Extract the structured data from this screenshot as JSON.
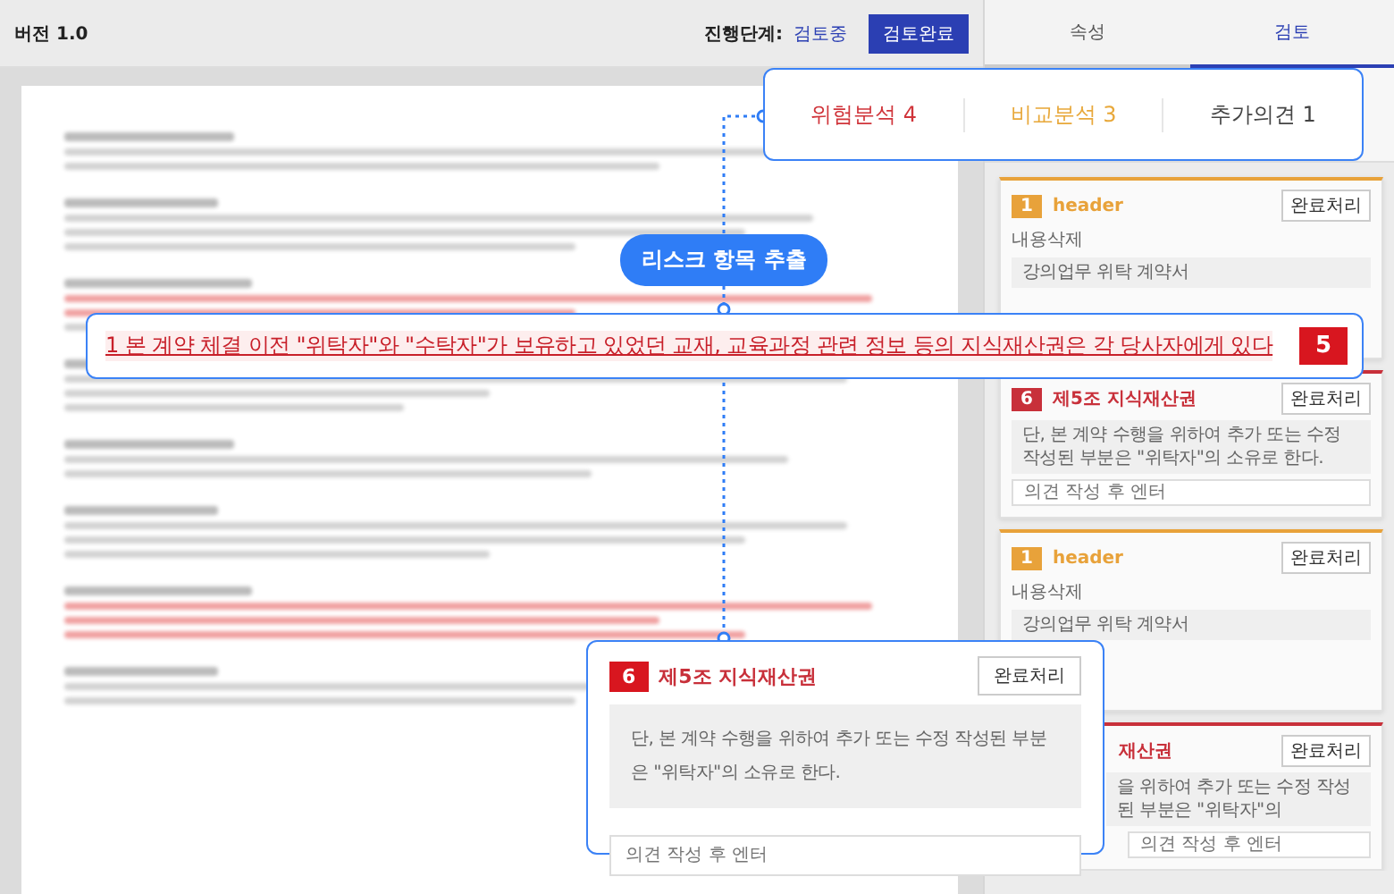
{
  "header": {
    "version": "버전 1.0",
    "stage_label": "진행단계:",
    "stage_value": "검토중",
    "complete_button": "검토완료"
  },
  "panel_tabs": [
    {
      "label": "속성",
      "selected": false
    },
    {
      "label": "검토",
      "selected": true
    }
  ],
  "review_cards": [
    {
      "kind": "header",
      "number": "1",
      "title": "header",
      "button": "완료처리",
      "subtitle": "내용삭제",
      "quote": "강의업무 위탁 계약서"
    },
    {
      "kind": "clause",
      "number": "6",
      "title": "제5조 지식재산권",
      "button": "완료처리",
      "quote": "단, 본 계약 수행을 위하여 추가 또는 수정 작성된 부분은 \"위탁자\"의 소유로 한다.",
      "placeholder": "의견 작성 후 엔터"
    },
    {
      "kind": "header",
      "number": "1",
      "title": "header",
      "button": "완료처리",
      "subtitle": "내용삭제",
      "quote": "강의업무 위탁 계약서"
    },
    {
      "kind": "clause",
      "title": "재산권",
      "button": "완료처리",
      "quote": "을 위하여 추가 또는 수정 작성된 부분은 \"위탁자\"의",
      "placeholder": "의견 작성 후 엔터"
    }
  ],
  "callout_tabs": [
    {
      "label": "위험분석 4",
      "color": "#d0343a"
    },
    {
      "label": "비교분석 3",
      "color": "#e8a83a"
    },
    {
      "label": "추가의견 1",
      "color": "#444444"
    }
  ],
  "extract_pill": "리스크 항목 추출",
  "highlight": {
    "text": "1 본 계약 체결 이전 \"위탁자\"와 \"수탁자\"가 보유하고 있었던 교재, 교육과정 관련 정보 등의 지식재산권은 각 당사자에게 있다",
    "badge": "5"
  },
  "popup": {
    "number": "6",
    "title": "제5조 지식재산권",
    "button": "완료처리",
    "quote": "단, 본 계약 수행을 위하여 추가 또는 수정 작성된 부분은 \"위탁자\"의 소유로 한다.",
    "placeholder": "의견 작성 후 엔터"
  }
}
